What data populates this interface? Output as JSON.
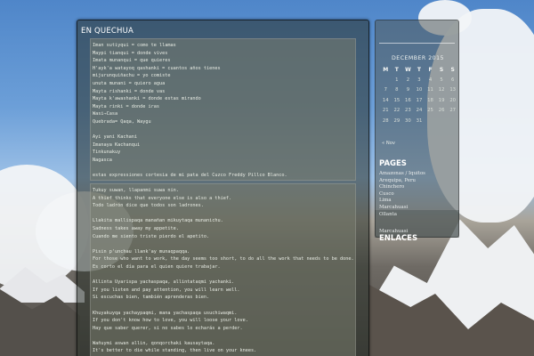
{
  "post": {
    "title": "EN QUECHUA",
    "block1_lines": [
      "Iman sutiyqui = como te llamas",
      "Maypi tianqui = donde vives",
      "Imata munanqui = que quieres",
      "H'ayk'a watayoq qashanki = cuantos años tienes",
      "mijurunquiñachu = yo comiste",
      "unuta munani = quiero agua",
      "Mayta rishanki = donde vas",
      "Mayta k'awashanki = donde estas mirando",
      "Mayta rinki = donde iras",
      "Wasi→Casa",
      "Quebrada= Qaqa, Waygu",
      "",
      "Ayi yani Kachani",
      "Imanaya Kachanqui",
      "Tinkunakuy",
      "Nagasca",
      "",
      "estas expressiones cortesia de mi pata del Cuzco Freddy Pillco Blanco."
    ],
    "block2_lines": [
      "Tukuy suwan, llapanmi suwa nin.",
      "A thief thinks that everyone else is also a thief.",
      "Todo ladrón dice que todos son ladrones.",
      "",
      "Llakita mallispaqa manañan mikuytaqa munanichu.",
      "Sadness takes away my appetite.",
      "Cuando me siento triste pierdo el apetito.",
      "",
      "Pisin p'unchau llank'ay munaqpaqqa.",
      "For those who want to work, the day seems too short, to do all the work that needs to be done.",
      "Es corto el día para el quien quiere trabajar.",
      "",
      "Allinta Uyarispa yachaspaqa, allintataqmi yachanki.",
      "If you listen and pay attention, you will learn well.",
      "Si escuchas bien, también aprenderas bien.",
      "",
      "Khuyakuyqa yachaypaqmi, mana yachaspaqa usuchiwaqmi.",
      "If you don't know how to love, you will loose your love.",
      "Hay que saber querer, si no sabes lo echarás a perder.",
      "",
      "Wañuymi aswan allin, qonqorchaki kausaytaqa.",
      "It's better to die while standing, then live on your knees."
    ]
  },
  "calendar": {
    "month": "DECEMBER 2015",
    "days_header": [
      "M",
      "T",
      "W",
      "T",
      "F",
      "S",
      "S"
    ],
    "weeks": [
      [
        "",
        "1",
        "2",
        "3",
        "4",
        "5",
        "6"
      ],
      [
        "7",
        "8",
        "9",
        "10",
        "11",
        "12",
        "13"
      ],
      [
        "14",
        "15",
        "16",
        "17",
        "18",
        "19",
        "20"
      ],
      [
        "21",
        "22",
        "23",
        "24",
        "25",
        "26",
        "27"
      ],
      [
        "28",
        "29",
        "30",
        "31",
        "",
        "",
        ""
      ]
    ],
    "prev": "« Nov"
  },
  "sidebar": {
    "pages_title": "PAGES",
    "pages": [
      "Amazonas / Iquitos",
      "Arequipa, Peru",
      "Chinchero",
      "Cusco",
      "Lima",
      "Marcahuasi",
      "Ollanta"
    ],
    "links_title": "ENLACES",
    "links": [
      "Marcahuasi"
    ]
  }
}
